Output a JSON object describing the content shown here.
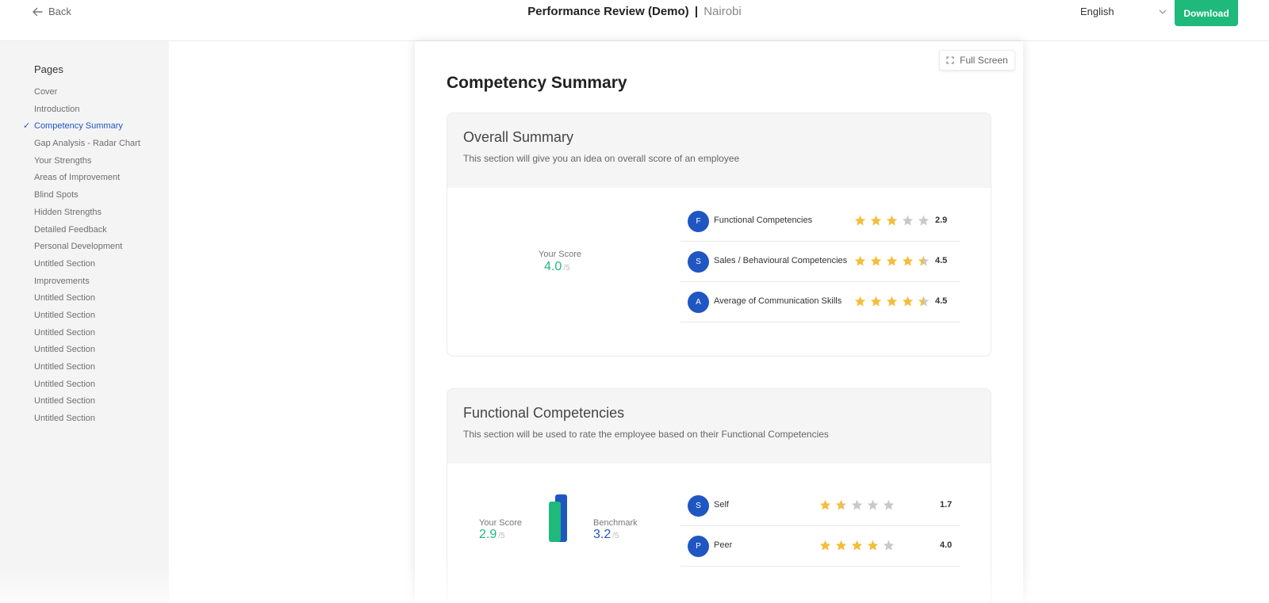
{
  "header": {
    "back_label": "Back",
    "title": "Performance Review (Demo)",
    "separator": "|",
    "location": "Nairobi",
    "language": "English",
    "download_label": "Download"
  },
  "sidebar": {
    "title": "Pages",
    "items": [
      {
        "label": "Cover",
        "active": false
      },
      {
        "label": "Introduction",
        "active": false
      },
      {
        "label": "Competency Summary",
        "active": true
      },
      {
        "label": "Gap Analysis - Radar Chart",
        "active": false
      },
      {
        "label": "Your Strengths",
        "active": false
      },
      {
        "label": "Areas of Improvement",
        "active": false
      },
      {
        "label": "Blind Spots",
        "active": false
      },
      {
        "label": "Hidden Strengths",
        "active": false
      },
      {
        "label": "Detailed Feedback",
        "active": false
      },
      {
        "label": "Personal Development",
        "active": false
      },
      {
        "label": "Untitled Section",
        "active": false
      },
      {
        "label": "Improvements",
        "active": false
      },
      {
        "label": "Untitled Section",
        "active": false
      },
      {
        "label": "Untitled Section",
        "active": false
      },
      {
        "label": "Untitled Section",
        "active": false
      },
      {
        "label": "Untitled Section",
        "active": false
      },
      {
        "label": "Untitled Section",
        "active": false
      },
      {
        "label": "Untitled Section",
        "active": false
      },
      {
        "label": "Untitled Section",
        "active": false
      },
      {
        "label": "Untitled Section",
        "active": false
      }
    ]
  },
  "paper": {
    "fullscreen_label": "Full Screen",
    "section_title": "Competency Summary",
    "overall": {
      "heading": "Overall Summary",
      "description": "This section will give you an idea on overall score of an employee",
      "score_label": "Your Score",
      "score": "4.0",
      "score_max": "/5",
      "rows": [
        {
          "initial": "F",
          "label": "Functional Competencies",
          "rating": 2.9,
          "value": "2.9"
        },
        {
          "initial": "S",
          "label": "Sales / Behavioural Competencies",
          "rating": 4.5,
          "value": "4.5"
        },
        {
          "initial": "A",
          "label": "Average of Communication Skills",
          "rating": 4.5,
          "value": "4.5"
        }
      ]
    },
    "functional": {
      "heading": "Functional Competencies",
      "description": "This section will be used to rate the employee based on their Functional Competencies",
      "score_label": "Your Score",
      "score": "2.9",
      "score_max": "/5",
      "benchmark_label": "Benchmark",
      "benchmark": "3.2",
      "benchmark_max": "/5",
      "score_value": 2.9,
      "benchmark_value": 3.2,
      "rows": [
        {
          "initial": "S",
          "label": "Self",
          "rating": 1.7,
          "value": "1.7"
        },
        {
          "initial": "P",
          "label": "Peer",
          "rating": 4.0,
          "value": "4.0"
        }
      ]
    }
  },
  "colors": {
    "accent_green": "#1eb97b",
    "accent_blue": "#1f56c2",
    "star_filled": "#f3be3b",
    "star_empty": "#c9c9c9"
  }
}
